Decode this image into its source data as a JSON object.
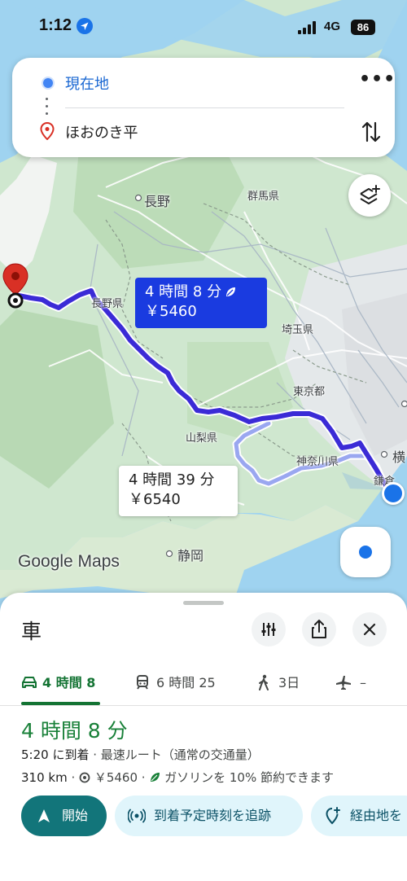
{
  "status_bar": {
    "time": "1:12",
    "network": "4G",
    "battery": "86"
  },
  "search": {
    "origin": "現在地",
    "destination": "ほおのき平"
  },
  "map": {
    "labels": {
      "nagano_city": "長野",
      "gunma": "群馬県",
      "nagano_pref": "長野県",
      "saitama": "埼玉県",
      "tokyo": "東京都",
      "yamanashi": "山梨県",
      "kanagawa": "神奈川県",
      "yokohama": "横",
      "kamakura": "鎌倉",
      "shizuoka": "静岡"
    },
    "route_main": {
      "time": "4 時間 8 分",
      "cost": "￥5460"
    },
    "route_alt": {
      "time": "4 時間 39 分",
      "cost": "￥6540"
    },
    "attribution": "Google Maps"
  },
  "sheet": {
    "mode": "車",
    "tabs": [
      {
        "icon": "car-icon",
        "label": "4 時間 8",
        "active": true
      },
      {
        "icon": "train-icon",
        "label": "6 時間 25",
        "active": false
      },
      {
        "icon": "walk-icon",
        "label": "3日",
        "active": false
      },
      {
        "icon": "flight-icon",
        "label": "–",
        "active": false
      }
    ],
    "duration": "4 時間 8 分",
    "arrival": "5:20 に到着",
    "route_note": "· 最速ルート（通常の交通量）",
    "distance": "310 km",
    "toll": "￥5460",
    "fuel_note": "ガソリンを 10% 節約できます",
    "buttons": {
      "start": "開始",
      "track": "到着予定時刻を追跡",
      "via": "経由地を"
    }
  },
  "colors": {
    "route": "#3b2bd6",
    "accent": "#137333",
    "start_btn": "#12757a",
    "chip_bg": "#e0f5fb"
  }
}
